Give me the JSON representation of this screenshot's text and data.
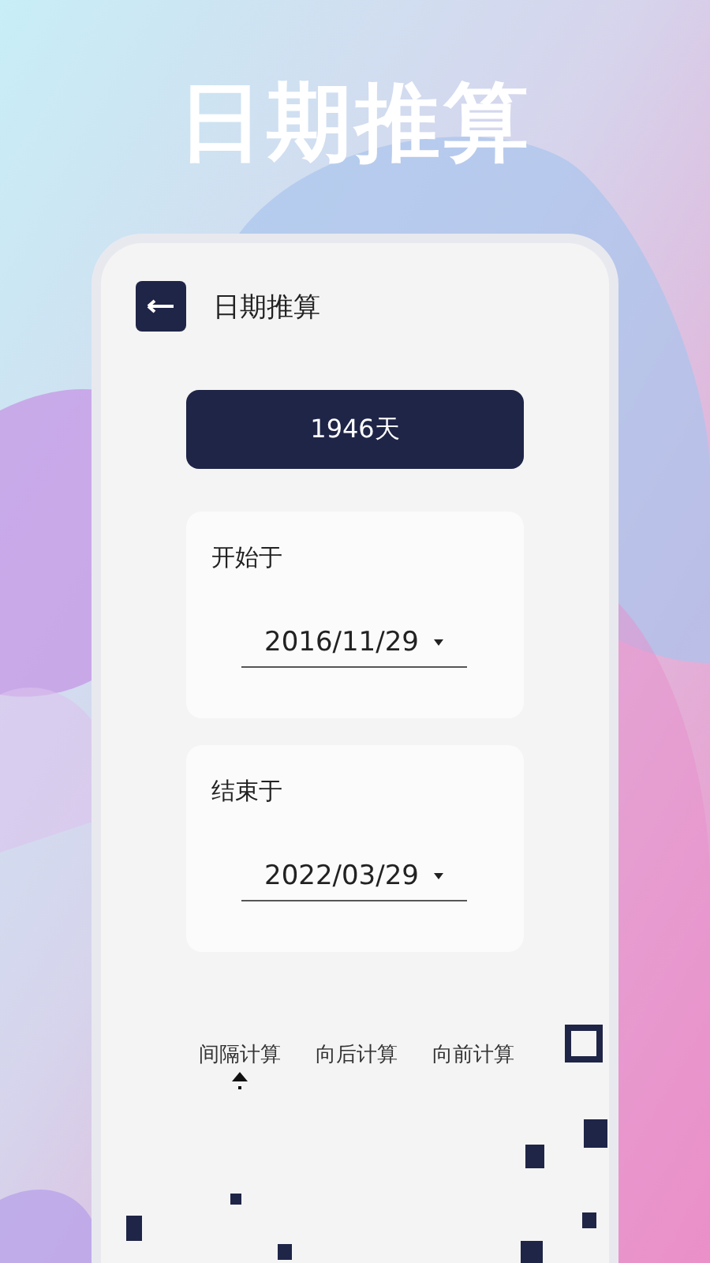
{
  "headline": "日期推算",
  "header": {
    "title": "日期推算"
  },
  "result": "1946天",
  "cards": [
    {
      "label": "开始于",
      "value": "2016/11/29"
    },
    {
      "label": "结束于",
      "value": "2022/03/29"
    }
  ],
  "tabs": [
    {
      "label": "间隔计算",
      "selected": true
    },
    {
      "label": "向后计算",
      "selected": false
    },
    {
      "label": "向前计算",
      "selected": false
    }
  ]
}
